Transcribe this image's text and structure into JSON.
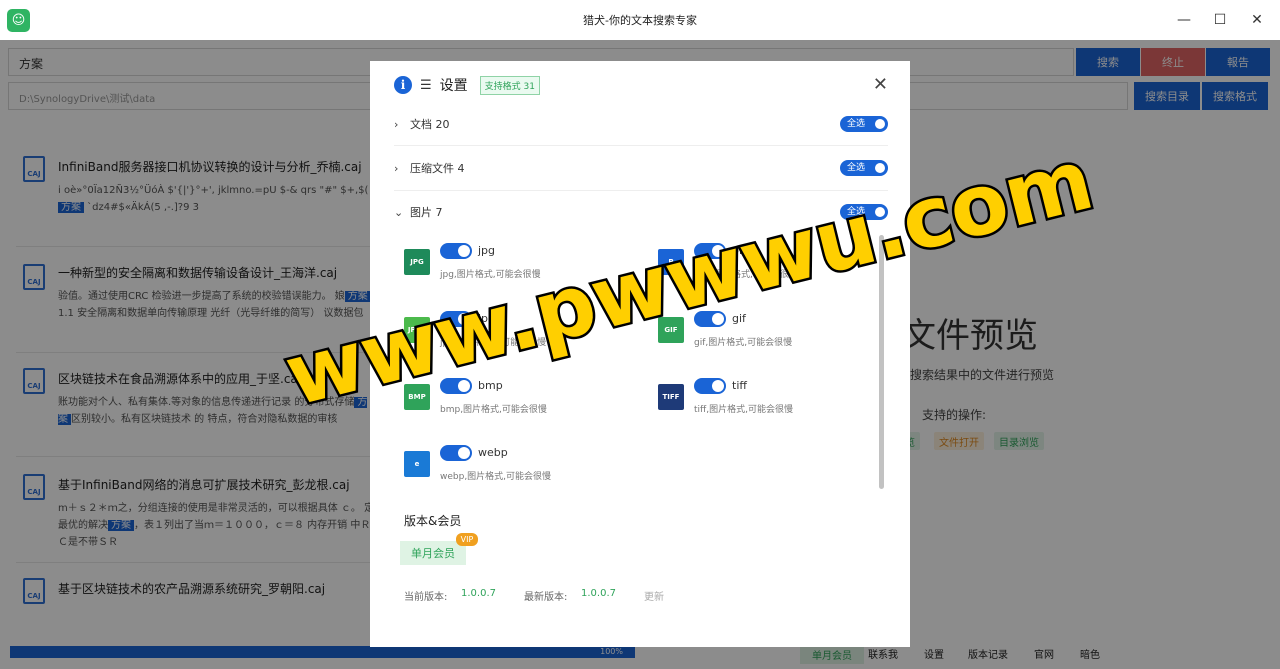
{
  "window": {
    "title": "猎犬-你的文本搜索专家",
    "minimize_glyph": "—",
    "maximize_glyph": "☐",
    "close_glyph": "✕"
  },
  "search": {
    "query": "方案",
    "path": "D:\\SynologyDrive\\测试\\data",
    "search_label": "搜索",
    "stop_label": "终止",
    "report_label": "報告",
    "search_dir_label": "搜索目录",
    "search_format_label": "搜索格式"
  },
  "results": [
    {
      "icon": "CAJ",
      "title": "InfiniBand服务器接口机协议转换的设计与分析_乔楠.caj",
      "snippet_pre": "i oè»°0Ïa12Ñ3½°ÜóÀ $'{|'}°+', jklmno.=pU $-& qrs \"#\" $+,$( ",
      "highlight": "方案",
      "snippet_post": " `dz4#$«ÄkÁ(5 ,-.]?9 3"
    },
    {
      "icon": "CAJ",
      "title": "一种新型的安全隔离和数据传输设备设计_王海洋.caj",
      "snippet_pre": "验值。通过使用CRC 检验进一步提高了系统的校验错误能力。 娘",
      "highlight": "方案",
      "snippet_post": " 1.1 安全隔离和数据单向传输原理 光纤（光导纤维的简写） 议数据包"
    },
    {
      "icon": "CAJ",
      "title": "区块链技术在食品溯源体系中的应用_于坚.caj",
      "snippet_pre": "账功能对个人、私有集体.等对象的信息传递进行记录 的分布式存储",
      "highlight": "方案",
      "snippet_post": "区别较小。私有区块链技术 的 特点，符合对隐私数据的审核"
    },
    {
      "icon": "CAJ",
      "title": "基于InfiniBand网络的消息可扩展技术研究_彭龙根.caj",
      "snippet_pre": "m＋ｓ２＊ｍ之，分组连接的使用是非常灵活的，可以根据具体 ｃ。 定最优的解决",
      "highlight": "方案",
      "snippet_post": "，表１列出了当ｍ＝１０００，ｃ＝８ 内存开销 中ＲＣ是不带ＳＲ"
    },
    {
      "icon": "CAJ",
      "title": "基于区块链技术的农产品溯源系统研究_罗朝阳.caj",
      "snippet_pre": "",
      "highlight": "",
      "snippet_post": ""
    }
  ],
  "preview": {
    "title": "文件预览",
    "subtitle": "搜索结果中的文件进行预览",
    "ops_label": "支持的操作:",
    "tags": [
      {
        "label": "览",
        "color": "#2fa35a"
      },
      {
        "label": "文件打开",
        "color": "#e08a20"
      },
      {
        "label": "目录浏览",
        "color": "#2fa35a"
      }
    ]
  },
  "progress": {
    "value": 1.0,
    "label": "100%"
  },
  "bottom_bar": {
    "vip": "单月会员",
    "links": [
      "联系我",
      "设置",
      "版本记录",
      "官网",
      "暗色"
    ]
  },
  "settings_modal": {
    "title": "设置",
    "badge": "支持格式 31",
    "close_glyph": "✕",
    "categories": [
      {
        "label": "文档 20",
        "expanded": false,
        "select_all": "全选"
      },
      {
        "label": "压缩文件 4",
        "expanded": false,
        "select_all": "全选"
      },
      {
        "label": "图片 7",
        "expanded": true,
        "select_all": "全选"
      }
    ],
    "formats": [
      {
        "name": "jpg",
        "desc": "jpg,图片格式,可能会很慢",
        "icon": "JPG",
        "color": "#1e8a5a",
        "enabled": true
      },
      {
        "name": "png",
        "desc": "png,图片格式,可能会很慢",
        "icon": "P",
        "color": "#1a64d6",
        "enabled": true
      },
      {
        "name": "jpeg",
        "desc": "jpeg,图片格式,可能会很慢",
        "icon": "JPEG",
        "color": "#4cba4c",
        "enabled": true
      },
      {
        "name": "gif",
        "desc": "gif,图片格式,可能会很慢",
        "icon": "GIF",
        "color": "#2fa35a",
        "enabled": true
      },
      {
        "name": "bmp",
        "desc": "bmp,图片格式,可能会很慢",
        "icon": "BMP",
        "color": "#2fa35a",
        "enabled": true
      },
      {
        "name": "tiff",
        "desc": "tiff,图片格式,可能会很慢",
        "icon": "TIFF",
        "color": "#1e3a78",
        "enabled": true
      },
      {
        "name": "webp",
        "desc": "webp,图片格式,可能会很慢",
        "icon": "e",
        "color": "#1a7ad6",
        "enabled": true
      }
    ],
    "version_section": {
      "label": "版本&会员",
      "vip_chip": "单月会员",
      "vip_badge": "VIP",
      "current_label": "当前版本:",
      "current_value": "1.0.0.7",
      "latest_label": "最新版本:",
      "latest_value": "1.0.0.7",
      "update_label": "更新"
    }
  },
  "watermark": "www.pwwwu.com"
}
